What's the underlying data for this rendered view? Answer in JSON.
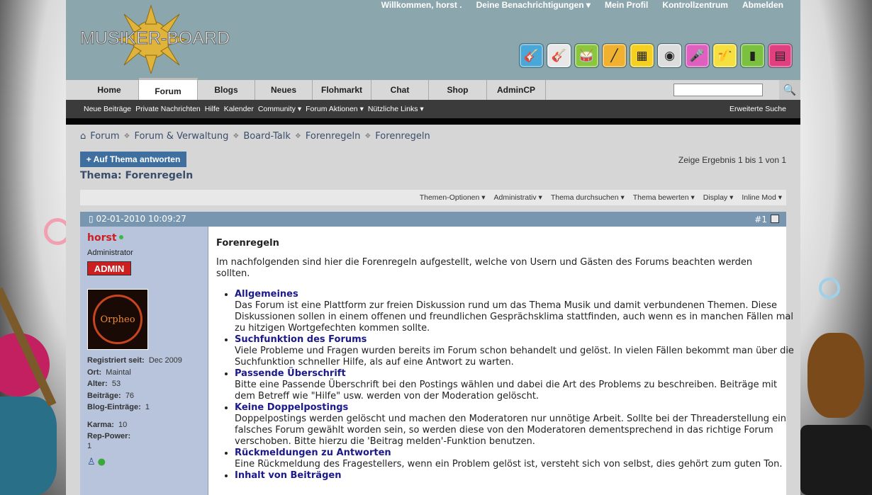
{
  "top_links": [
    "Willkommen,  horst .",
    "Deine Benachrichtigungen ▾",
    "Mein Profil",
    "Kontrollzentrum",
    "Abmelden"
  ],
  "logo": {
    "text": "MUSIKER-BOARD"
  },
  "instrument_icons": [
    "acoustic-guitar-icon",
    "electric-guitar-icon",
    "drums-icon",
    "flute-icon",
    "keyboard-icon",
    "amplifier-icon",
    "microphone-icon",
    "saxophone-icon",
    "speaker-icon",
    "mixer-icon"
  ],
  "nav": {
    "tabs": [
      "Home",
      "Forum",
      "Blogs",
      "Neues",
      "Flohmarkt",
      "Chat",
      "Shop",
      "AdminCP"
    ],
    "active": "Forum"
  },
  "subnav": {
    "items": [
      "Neue Beiträge",
      "Private Nachrichten",
      "Hilfe",
      "Kalender",
      "Community ▾",
      "Forum Aktionen ▾",
      "Nützliche Links ▾"
    ],
    "advanced_search": "Erweiterte Suche"
  },
  "breadcrumb": [
    "Forum",
    "Forum & Verwaltung",
    "Board-Talk",
    "Forenregeln",
    "Forenregeln"
  ],
  "reply_button": "+ Auf Thema antworten",
  "results": "Zeige Ergebnis 1 bis 1 von 1",
  "thread_title": "Thema: Forenregeln",
  "thread_tools": [
    "Themen-Optionen ▾",
    "Administrativ ▾",
    "Thema durchsuchen ▾",
    "Thema bewerten ▾",
    "Display ▾",
    "Inline Mod ▾"
  ],
  "post": {
    "date": "02-01-2010 10:09:27",
    "number": "#1",
    "user": {
      "name": "horst",
      "title": "Administrator",
      "badge": "ADMIN",
      "avatar_text": "Orpheo",
      "fields": [
        {
          "label": "Registriert seit:",
          "value": "Dec 2009"
        },
        {
          "label": "Ort:",
          "value": "Maintal"
        },
        {
          "label": "Alter:",
          "value": "53"
        },
        {
          "label": "Beiträge:",
          "value": "76"
        },
        {
          "label": "Blog-Einträge:",
          "value": "1"
        }
      ],
      "karma_label": "Karma:",
      "karma": "10",
      "rep_label": "Rep-Power:",
      "rep": "1"
    },
    "title": "Forenregeln",
    "intro": "Im nachfolgenden sind hier die Forenregeln aufgestellt, welche von Usern und Gästen des Forums beachten werden sollten.",
    "rules": [
      {
        "heading": "Allgemeines",
        "text": "Das Forum ist eine Plattform zur freien Diskussion rund um das Thema Musik und damit verbundenen Themen. Diese Diskussionen sollen in einem offenen und freundlichen Gesprächsklima stattfinden, auch wenn es in manchen Fällen mal zu hitzigen Wortgefechten kommen sollte."
      },
      {
        "heading": "Suchfunktion des Forums",
        "text": "Viele Probleme und Fragen wurden bereits im Forum schon behandelt und gelöst. In vielen Fällen bekommt man über die Suchfunktion schneller Hilfe, als auf eine Antwort zu warten."
      },
      {
        "heading": "Passende Überschrift",
        "text": "Bitte eine Passende Überschrift bei den Postings wählen und dabei die Art des Problems zu beschreiben. Beiträge mit dem Betreff wie \"Hilfe\" usw. werden von der Moderation gelöscht."
      },
      {
        "heading": "Keine Doppelpostings",
        "text": "Doppelpostings werden gelöscht und machen den Moderatoren nur unnötige Arbeit. Sollte bei der Threaderstellung ein falsches Forum gewählt worden sein, so werden diese von den Moderatoren dementsprechend in das richtige Forum verschoben. Bitte hierzu die 'Beitrag melden'-Funktion benutzen."
      },
      {
        "heading": "Rückmeldungen zu Antworten",
        "text": "Eine Rückmeldung des Fragestellers, wenn ein Problem gelöst ist, versteht sich von selbst, dies gehört zum guten Ton."
      },
      {
        "heading": "Inhalt von Beiträgen",
        "text": ""
      }
    ]
  },
  "colors": {
    "header": "#8ca6ad",
    "post_header": "#7896b0",
    "user_panel": "#b7c4db",
    "link": "#3a4e6b",
    "username": "#cc1f1f"
  }
}
